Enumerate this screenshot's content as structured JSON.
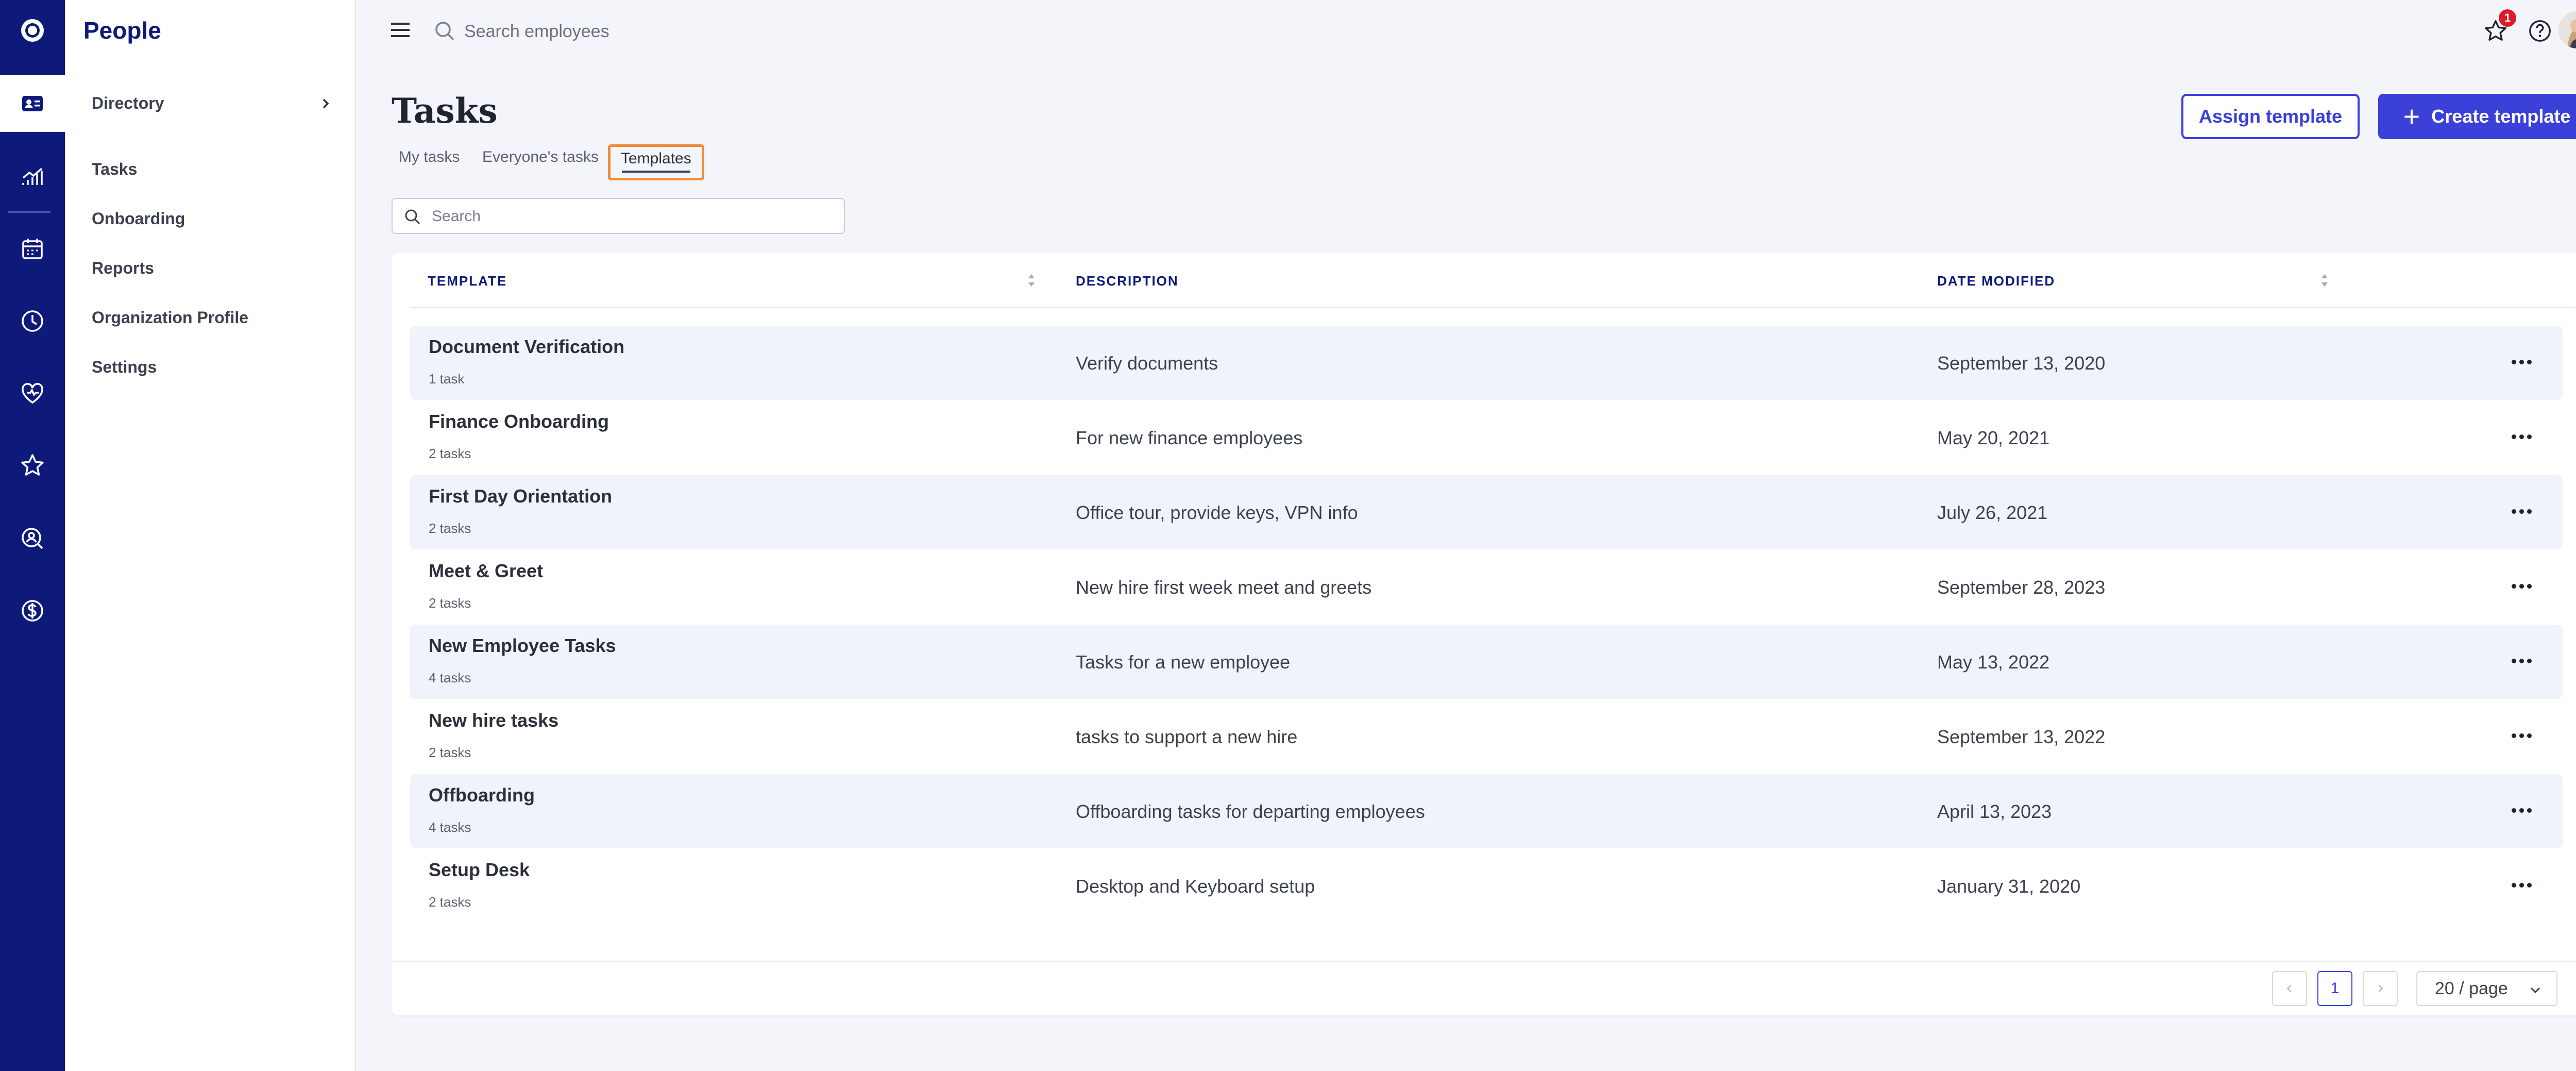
{
  "app": {
    "title": "People"
  },
  "topbar": {
    "search_placeholder": "Search employees",
    "notification_count": "1"
  },
  "sidebar": {
    "items": [
      {
        "label": "Directory"
      },
      {
        "label": "Tasks"
      },
      {
        "label": "Onboarding"
      },
      {
        "label": "Reports"
      },
      {
        "label": "Organization Profile"
      },
      {
        "label": "Settings"
      }
    ]
  },
  "rail": {
    "icons": [
      "logo-icon",
      "people-card-icon",
      "analytics-icon",
      "calendar-icon",
      "clock-icon",
      "heart-icon",
      "star-icon",
      "search-person-icon",
      "dollar-icon"
    ]
  },
  "page": {
    "title": "Tasks",
    "tabs": [
      {
        "label": "My tasks"
      },
      {
        "label": "Everyone's tasks"
      },
      {
        "label": "Templates"
      }
    ],
    "assign_button": "Assign template",
    "create_button": "Create template",
    "search_placeholder": "Search"
  },
  "table": {
    "columns": [
      "TEMPLATE",
      "DESCRIPTION",
      "DATE MODIFIED"
    ],
    "rows": [
      {
        "name": "Document Verification",
        "count": "1 task",
        "description": "Verify documents",
        "date": "September 13, 2020"
      },
      {
        "name": "Finance Onboarding",
        "count": "2 tasks",
        "description": "For new finance employees",
        "date": "May 20, 2021"
      },
      {
        "name": "First Day Orientation",
        "count": "2 tasks",
        "description": "Office tour, provide keys, VPN info",
        "date": "July 26, 2021"
      },
      {
        "name": "Meet & Greet",
        "count": "2 tasks",
        "description": "New hire first week meet and greets",
        "date": "September 28, 2023"
      },
      {
        "name": "New Employee Tasks",
        "count": "4 tasks",
        "description": "Tasks for a new employee",
        "date": "May 13, 2022"
      },
      {
        "name": "New hire tasks",
        "count": "2 tasks",
        "description": "tasks to support a new hire",
        "date": "September 13, 2022"
      },
      {
        "name": "Offboarding",
        "count": "4 tasks",
        "description": "Offboarding tasks for departing employees",
        "date": "April 13, 2023"
      },
      {
        "name": "Setup Desk",
        "count": "2 tasks",
        "description": "Desktop and Keyboard setup",
        "date": "January 31, 2020"
      }
    ]
  },
  "pagination": {
    "current_page": "1",
    "page_size": "20 / page"
  },
  "colors": {
    "rail": "#0d1a7a",
    "accent": "#3a40d8",
    "selected_tab_outline": "#f08a3c",
    "badge": "#d91e2a"
  }
}
